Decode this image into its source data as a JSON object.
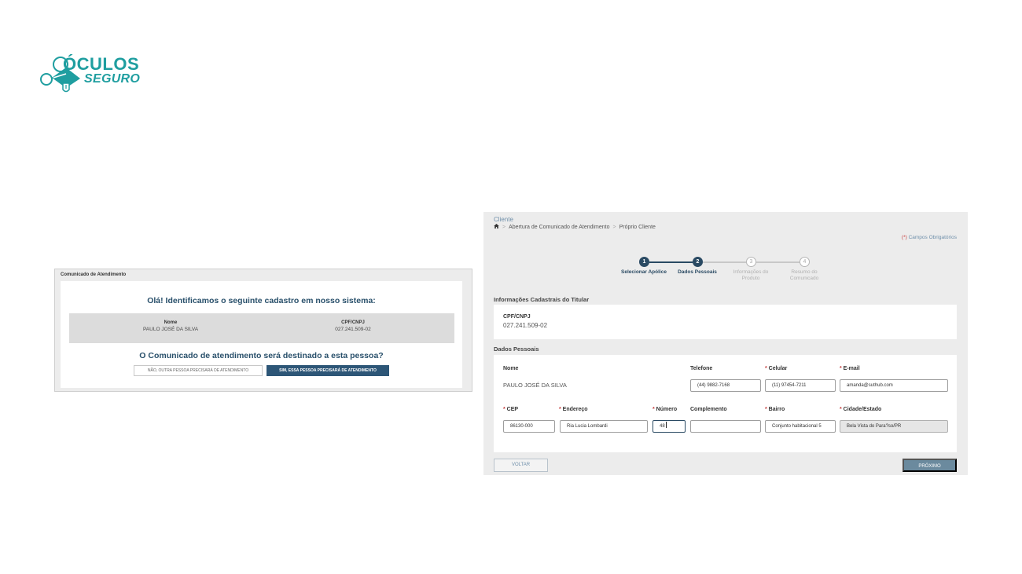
{
  "brand": {
    "line1": "ÓCULOS",
    "line2": "SEGURO",
    "color": "#1f9ea0"
  },
  "confirm_panel": {
    "header": "Comunicado de Atendimento",
    "greeting": "Olá! Identificamos o seguinte cadastro em nosso sistema:",
    "record": {
      "name_label": "Nome",
      "name_value": "PAULO JOSÉ DA SILVA",
      "doc_label": "CPF/CNPJ",
      "doc_value": "027.241.509-02"
    },
    "question": "O Comunicado de atendimento será destinado a esta pessoa?",
    "no_button": "NÃO, OUTRA PESSOA PRECISARÁ DE ATENDIMENTO",
    "yes_button": "SIM, ESSA PESSOA PRECISARÁ DE ATENDIMENTO"
  },
  "form_panel": {
    "title": "Cliente",
    "breadcrumb": [
      "Abertura de Comunicado de Atendimento",
      "Próprio Cliente"
    ],
    "required_note_star": "(*)",
    "required_note": "Campos Obrigatórios",
    "steps": [
      {
        "number": "1",
        "label": "Selecionar Apólice",
        "state": "done"
      },
      {
        "number": "2",
        "label": "Dados Pessoais",
        "state": "done"
      },
      {
        "number": "3",
        "label": "Informações do\nProduto",
        "state": "todo"
      },
      {
        "number": "4",
        "label": "Resumo do\nComunicado",
        "state": "todo"
      }
    ],
    "holder_section": {
      "title": "Informações Cadastrais do Titular",
      "doc_label": "CPF/CNPJ",
      "doc_value": "027.241.509-02"
    },
    "personal_section": {
      "title": "Dados Pessoais",
      "name_label": "Nome",
      "name_value": "PAULO JOSÉ DA SILVA",
      "phone_label": "Telefone",
      "phone_value": "(44) 9882-7168",
      "mobile_label": "Celular",
      "mobile_value": "(11) 97454-7211",
      "email_label": "E-mail",
      "email_value": "amanda@suthub.com",
      "cep_label": "CEP",
      "cep_value": "86130-000",
      "address_label": "Endereço",
      "address_value": "Ria Lucia Lombardi",
      "number_label": "Número",
      "number_value": "48",
      "complement_label": "Complemento",
      "complement_value": "",
      "district_label": "Bairro",
      "district_value": "Conjunto habitacional 5",
      "city_label": "Cidade/Estado",
      "city_value": "Bela Vista do Para?so/PR"
    },
    "back_button": "VOLTAR",
    "next_button": "PRÓXIMO"
  },
  "colors": {
    "primary_dark": "#2d5677",
    "step_active": "#2a4a63",
    "required": "#c43b3b",
    "next_button": "#6b8a9e"
  }
}
